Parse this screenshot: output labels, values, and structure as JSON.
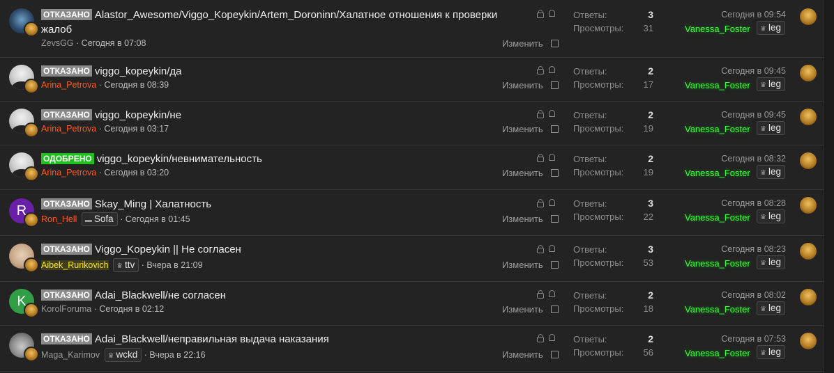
{
  "labels": {
    "replies": "Ответы:",
    "views": "Просмотры:",
    "edit": "Изменить"
  },
  "threads": [
    {
      "status": "ОТКАЗАНО",
      "title": "Alastor_Awesome/Viggo_Kopeykin/Artem_Doroninn/Халатное отношения к проверки",
      "title_cont": "жалоб",
      "author": "ZevsGG",
      "author_badge": "",
      "created": "· Сегодня в 07:08",
      "replies": "3",
      "views": "31",
      "last_date": "Сегодня в 09:54",
      "last_user": "Vanessa_Foster",
      "last_badge": "leg"
    },
    {
      "status": "ОТКАЗАНО",
      "title": "viggo_kopeykin/да",
      "author": "Arina_Petrova",
      "author_badge": "",
      "created": "· Сегодня в 08:39",
      "replies": "2",
      "views": "17",
      "last_date": "Сегодня в 09:45",
      "last_user": "Vanessa_Foster",
      "last_badge": "leg"
    },
    {
      "status": "ОТКАЗАНО",
      "title": "viggo_kopeykin/не",
      "author": "Arina_Petrova",
      "author_badge": "",
      "created": "· Сегодня в 03:17",
      "replies": "2",
      "views": "19",
      "last_date": "Сегодня в 09:45",
      "last_user": "Vanessa_Foster",
      "last_badge": "leg"
    },
    {
      "status": "ОДОБРЕНО",
      "title": "viggo_kopeykin/невнимательность",
      "author": "Arina_Petrova",
      "author_badge": "",
      "created": "· Сегодня в 03:20",
      "replies": "2",
      "views": "19",
      "last_date": "Сегодня в 08:32",
      "last_user": "Vanessa_Foster",
      "last_badge": "leg"
    },
    {
      "status": "ОТКАЗАНО",
      "title": "Skay_Ming | Халатность",
      "author": "Ron_Hell",
      "author_badge": "Sofa",
      "created": "· Сегодня в 01:45",
      "replies": "3",
      "views": "22",
      "last_date": "Сегодня в 08:28",
      "last_user": "Vanessa_Foster",
      "last_badge": "leg",
      "avatar_letter": "R"
    },
    {
      "status": "ОТКАЗАНО",
      "title": "Viggo_Kopeykin || Не согласен",
      "author": "Aibek_Rurikovich",
      "author_badge": "ttv",
      "created": "· Вчера в 21:09",
      "replies": "3",
      "views": "53",
      "last_date": "Сегодня в 08:23",
      "last_user": "Vanessa_Foster",
      "last_badge": "leg"
    },
    {
      "status": "ОТКАЗАНО",
      "title": "Adai_Blackwell/не согласен",
      "author": "KorolForuma",
      "author_badge": "",
      "created": "· Сегодня в 02:12",
      "replies": "2",
      "views": "18",
      "last_date": "Сегодня в 08:02",
      "last_user": "Vanessa_Foster",
      "last_badge": "leg",
      "avatar_letter": "K"
    },
    {
      "status": "ОТКАЗАНО",
      "title": "Adai_Blackwell/неправильная выдача наказания",
      "author": "Maga_Karimov",
      "author_badge": "wckd",
      "created": "· Вчера в 22:16",
      "replies": "2",
      "views": "56",
      "last_date": "Сегодня в 07:53",
      "last_user": "Vanessa_Foster",
      "last_badge": "leg"
    }
  ]
}
